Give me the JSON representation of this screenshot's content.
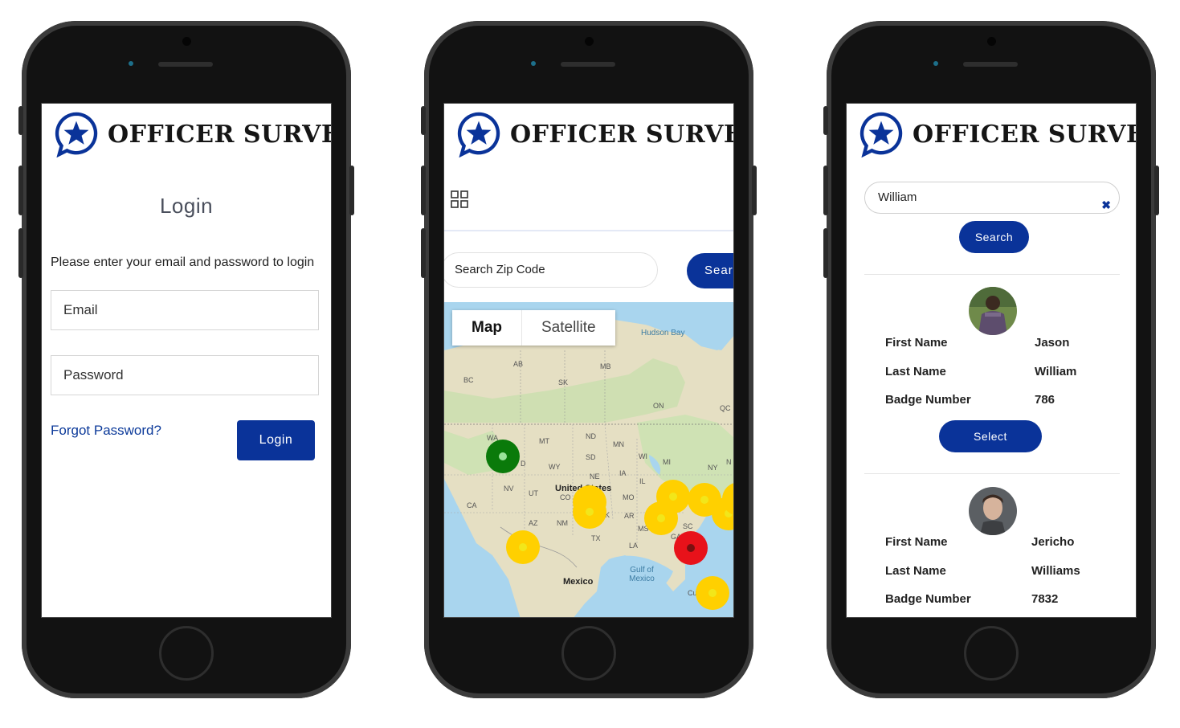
{
  "brand": {
    "title": "OFFICER SURVEY",
    "color": "#0a3399"
  },
  "login": {
    "heading": "Login",
    "prompt": "Please enter your email and password to login",
    "email_placeholder": "Email",
    "password_placeholder": "Password",
    "forgot_link": "Forgot Password?",
    "login_button": "Login"
  },
  "map_screen": {
    "menu_icon": "grid-icon",
    "zip_placeholder": "Search Zip Code",
    "search_button": "Search",
    "map_types": [
      "Map",
      "Satellite"
    ],
    "labels": {
      "hudson_bay": "Hudson Bay",
      "ab": "AB",
      "bc": "BC",
      "sk": "SK",
      "mb": "MB",
      "on": "ON",
      "qc": "QC",
      "wa": "WA",
      "mt": "MT",
      "nd": "ND",
      "mn": "MN",
      "wi": "WI",
      "mi": "MI",
      "ny": "NY",
      "n": "N",
      "sd": "SD",
      "wy": "WY",
      "id": "D",
      "nv": "NV",
      "ut": "UT",
      "ne": "NE",
      "ia": "IA",
      "il": "IL",
      "co": "CO",
      "united_states": "United States",
      "ca": "CA",
      "mo": "MO",
      "k": "K",
      "ar": "AR",
      "az": "AZ",
      "nm": "NM",
      "ms": "MS",
      "sc": "SC",
      "ga": "GA",
      "tx": "TX",
      "la": "LA",
      "gulf": "Gulf of Mexico",
      "mexico": "Mexico",
      "cu": "Cu"
    },
    "markers": [
      {
        "status": "green"
      },
      {
        "status": "yellow"
      },
      {
        "status": "yellow"
      },
      {
        "status": "yellow"
      },
      {
        "status": "yellow"
      },
      {
        "status": "yellow"
      },
      {
        "status": "yellow"
      },
      {
        "status": "yellow"
      },
      {
        "status": "yellow"
      },
      {
        "status": "red"
      },
      {
        "status": "yellow"
      }
    ],
    "colors": {
      "green": "#0a7a0a",
      "yellow": "#ffd000",
      "red": "#e8121a"
    }
  },
  "officer_search": {
    "query": "William",
    "search_button": "Search",
    "results": [
      {
        "first_name_label": "First Name",
        "first_name": "Jason",
        "last_name_label": "Last Name",
        "last_name": "William",
        "badge_label": "Badge Number",
        "badge": "786",
        "select_button": "Select"
      },
      {
        "first_name_label": "First Name",
        "first_name": "Jericho",
        "last_name_label": "Last Name",
        "last_name": "Williams",
        "badge_label": "Badge Number",
        "badge": "7832"
      }
    ]
  }
}
